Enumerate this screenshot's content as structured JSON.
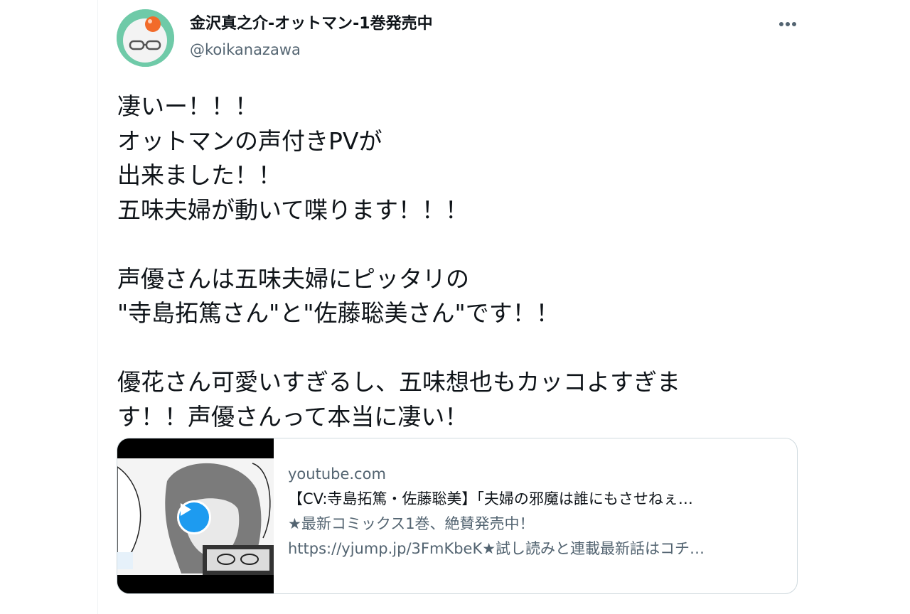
{
  "tweet": {
    "author": {
      "display_name": "金沢真之介-オットマン-1巻発売中",
      "handle": "@koikanazawa",
      "avatar_icon": "avatar-glasses-icon"
    },
    "more_icon": "more-horizontal-icon",
    "text": "凄いー！！！\nオットマンの声付きPVが\n出来ました！！\n五味夫婦が動いて喋ります！！！\n\n声優さんは五味夫婦にピッタリの\n\"寺島拓篤さん\"と\"佐藤聡美さん\"です！！\n\n優花さん可愛いすぎるし、五味想也もカッコよすぎま\nす！！声優さんって本当に凄い！",
    "card": {
      "domain": "youtube.com",
      "title": "【CV:寺島拓篤・佐藤聡美】「夫婦の邪魔は誰にもさせねぇ…",
      "desc_line1": "★最新コミックス1巻、絶賛発売中！",
      "desc_line2": "https://yjump.jp/3FmKbeK★試し読みと連載最新話はコチ…",
      "play_icon": "play-icon"
    }
  },
  "colors": {
    "text_primary": "#0f1419",
    "text_secondary": "#536471",
    "accent": "#1d9bf0",
    "border": "#cfd9de"
  }
}
